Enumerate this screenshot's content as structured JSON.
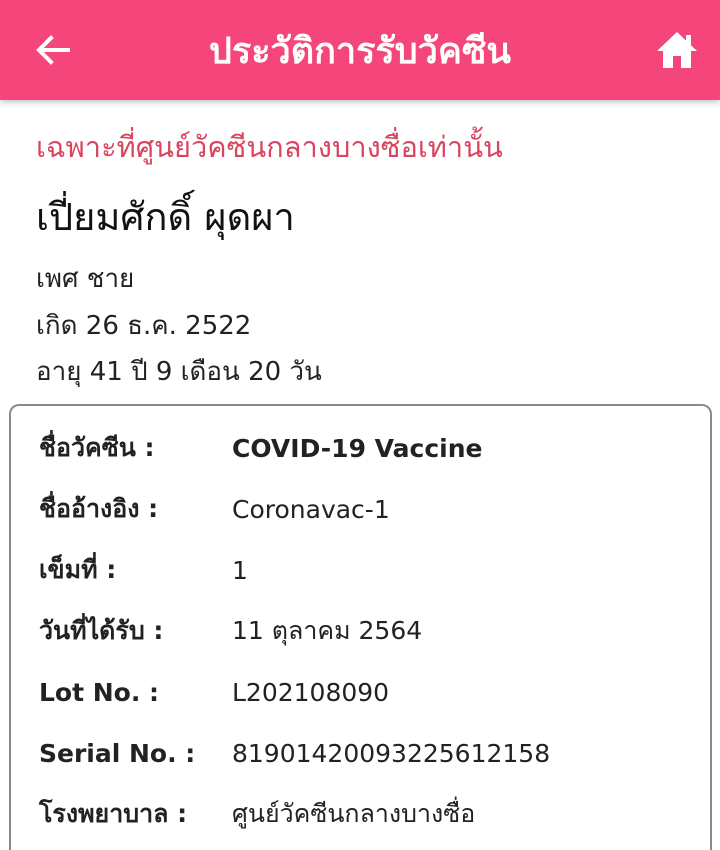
{
  "header": {
    "title": "ประวัติการรับวัคซีน",
    "back_icon": "arrow-left-icon",
    "home_icon": "home-icon"
  },
  "notice": "เฉพาะที่ศูนย์วัคซีนกลางบางซื่อเท่านั้น",
  "person": {
    "name": "เปี่ยมศักดิ์ ผุดผา",
    "gender": "เพศ ชาย",
    "birth": "เกิด 26 ธ.ค. 2522",
    "age": "อายุ 41 ปี 9 เดือน 20 วัน"
  },
  "vaccine": {
    "rows": [
      {
        "label": "ชื่อวัคซีน :",
        "value": "COVID-19 Vaccine"
      },
      {
        "label": "ชื่ออ้างอิง :",
        "value": "Coronavac-1"
      },
      {
        "label": "เข็มที่ :",
        "value": "1"
      },
      {
        "label": "วันที่ได้รับ :",
        "value": "11 ตุลาคม 2564"
      },
      {
        "label": "Lot No. :",
        "value": "L202108090"
      },
      {
        "label": "Serial No. :",
        "value": "8190142009322561215​8"
      },
      {
        "label": "โรงพยาบาล :",
        "value": "ศูนย์วัคซีนกลางบางซื่อ"
      }
    ]
  },
  "colors": {
    "header_bg": "#f5467b",
    "notice_text": "#d8455f"
  }
}
